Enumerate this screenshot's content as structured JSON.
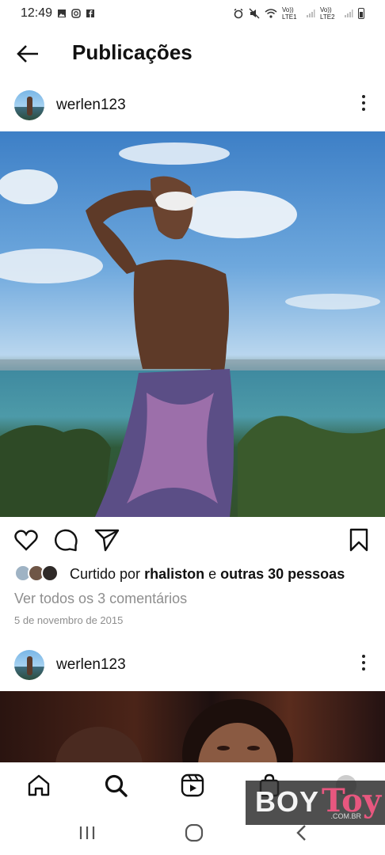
{
  "status_bar": {
    "time": "12:49",
    "left_icons": [
      "image-icon",
      "instagram-icon",
      "facebook-icon"
    ],
    "right_icons": [
      "alarm-icon",
      "mute-icon",
      "wifi-icon",
      "signal-icon",
      "signal-icon",
      "battery-icon"
    ],
    "sim1": "Vo)) LTE1",
    "sim2": "Vo)) LTE2"
  },
  "header": {
    "title": "Publicações",
    "back_icon": "arrow-left-icon"
  },
  "posts": [
    {
      "username": "werlen123",
      "photo_icon": "beach-photo",
      "likes_prefix": "Curtido por",
      "liked_by": "rhaliston",
      "likes_joiner": "e",
      "others": "outras 30 pessoas",
      "comments_link": "Ver todos os 3 comentários",
      "date": "5 de novembro de 2015"
    },
    {
      "username": "werlen123",
      "photo_icon": "portrait-photo"
    }
  ],
  "bottom_nav": [
    "home-icon",
    "search-icon",
    "reels-icon",
    "shop-icon",
    "profile-icon"
  ],
  "system_nav": [
    "recents-icon",
    "home-circle-icon",
    "back-chevron-icon"
  ],
  "watermark": {
    "boy": "BOY",
    "toy": "Toy",
    "domain": ".COM.BR"
  },
  "colors": {
    "text": "#111111",
    "muted": "#8e8e8e",
    "watermark_accent": "#e8577f"
  }
}
